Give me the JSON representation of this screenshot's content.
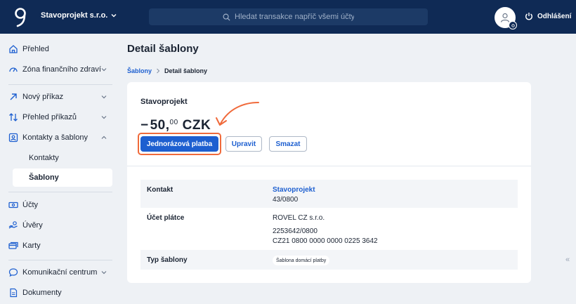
{
  "header": {
    "company": "Stavoprojekt s.r.o.",
    "search_placeholder": "Hledat transakce napříč všemi účty",
    "logout_label": "Odhlášení"
  },
  "sidebar": {
    "items": [
      {
        "label": "Přehled",
        "icon": "home-icon"
      },
      {
        "label": "Zóna finančního zdraví",
        "icon": "gauge-icon"
      },
      {
        "label": "Nový příkaz",
        "icon": "arrow-up-right-icon"
      },
      {
        "label": "Přehled příkazů",
        "icon": "arrows-updown-icon"
      },
      {
        "label": "Kontakty a šablony",
        "icon": "contact-card-icon"
      },
      {
        "label": "Kontakty"
      },
      {
        "label": "Šablony"
      },
      {
        "label": "Účty",
        "icon": "banknote-icon"
      },
      {
        "label": "Úvěry",
        "icon": "loan-hand-icon"
      },
      {
        "label": "Karty",
        "icon": "cards-icon"
      },
      {
        "label": "Komunikační centrum",
        "icon": "chat-icon"
      },
      {
        "label": "Dokumenty",
        "icon": "document-icon"
      }
    ]
  },
  "page": {
    "title": "Detail šablony",
    "breadcrumb": {
      "parent": "Šablony",
      "current": "Detail šablony"
    }
  },
  "template": {
    "name": "Stavoprojekt",
    "amount_sign": "−",
    "amount_int": "50,",
    "amount_dec": "00",
    "currency": "CZK",
    "buttons": {
      "one_time": "Jednorázová platba",
      "edit": "Upravit",
      "delete": "Smazat"
    },
    "details": {
      "contact_label": "Kontakt",
      "contact_name": "Stavoprojekt",
      "contact_account": "43/0800",
      "payer_label": "Účet plátce",
      "payer_name": "ROVEL CZ s.r.o.",
      "payer_account": "2253642/0800",
      "payer_iban": "CZ21 0800 0000 0000 0225 3642",
      "type_label": "Typ šablony",
      "type_value": "Šablona domácí platby"
    }
  },
  "colors": {
    "topbar": "#0f2a55",
    "accent": "#1d5fd0",
    "highlight": "#f06a3b"
  }
}
